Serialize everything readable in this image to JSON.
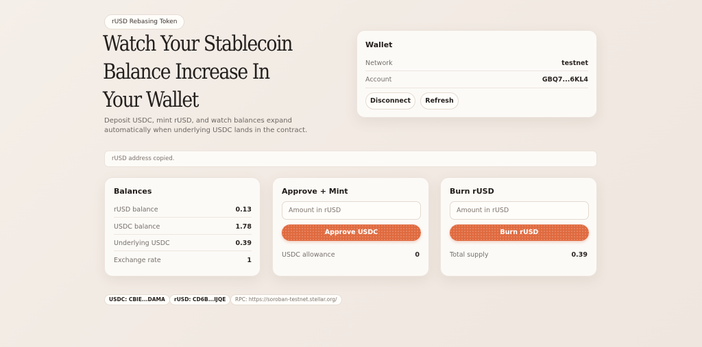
{
  "hero": {
    "badge": "rUSD Rebasing Token",
    "title": "Watch Your Stablecoin Balance Increase In Your Wallet",
    "subtitle": "Deposit USDC, mint rUSD, and watch balances expand automatically when underlying USDC lands in the contract."
  },
  "wallet": {
    "title": "Wallet",
    "network_label": "Network",
    "network_value": "testnet",
    "account_label": "Account",
    "account_value": "GBQ7...6KL4",
    "disconnect_label": "Disconnect",
    "refresh_label": "Refresh"
  },
  "status": {
    "message": "rUSD address copied."
  },
  "balances": {
    "title": "Balances",
    "rows": [
      {
        "label": "rUSD balance",
        "value": "0.13"
      },
      {
        "label": "USDC balance",
        "value": "1.78"
      },
      {
        "label": "Underlying USDC",
        "value": "0.39"
      },
      {
        "label": "Exchange rate",
        "value": "1"
      }
    ]
  },
  "mint": {
    "title": "Approve + Mint",
    "input_placeholder": "Amount in rUSD",
    "button_label": "Approve USDC",
    "allowance_label": "USDC allowance",
    "allowance_value": "0"
  },
  "burn": {
    "title": "Burn rUSD",
    "input_placeholder": "Amount in rUSD",
    "button_label": "Burn rUSD",
    "supply_label": "Total supply",
    "supply_value": "0.39"
  },
  "footer": {
    "usdc": "USDC: CBIE...DAMA",
    "rusd": "rUSD: CD6B...IJQE",
    "rpc": "RPC: https://soroban-testnet.stellar.org/"
  }
}
